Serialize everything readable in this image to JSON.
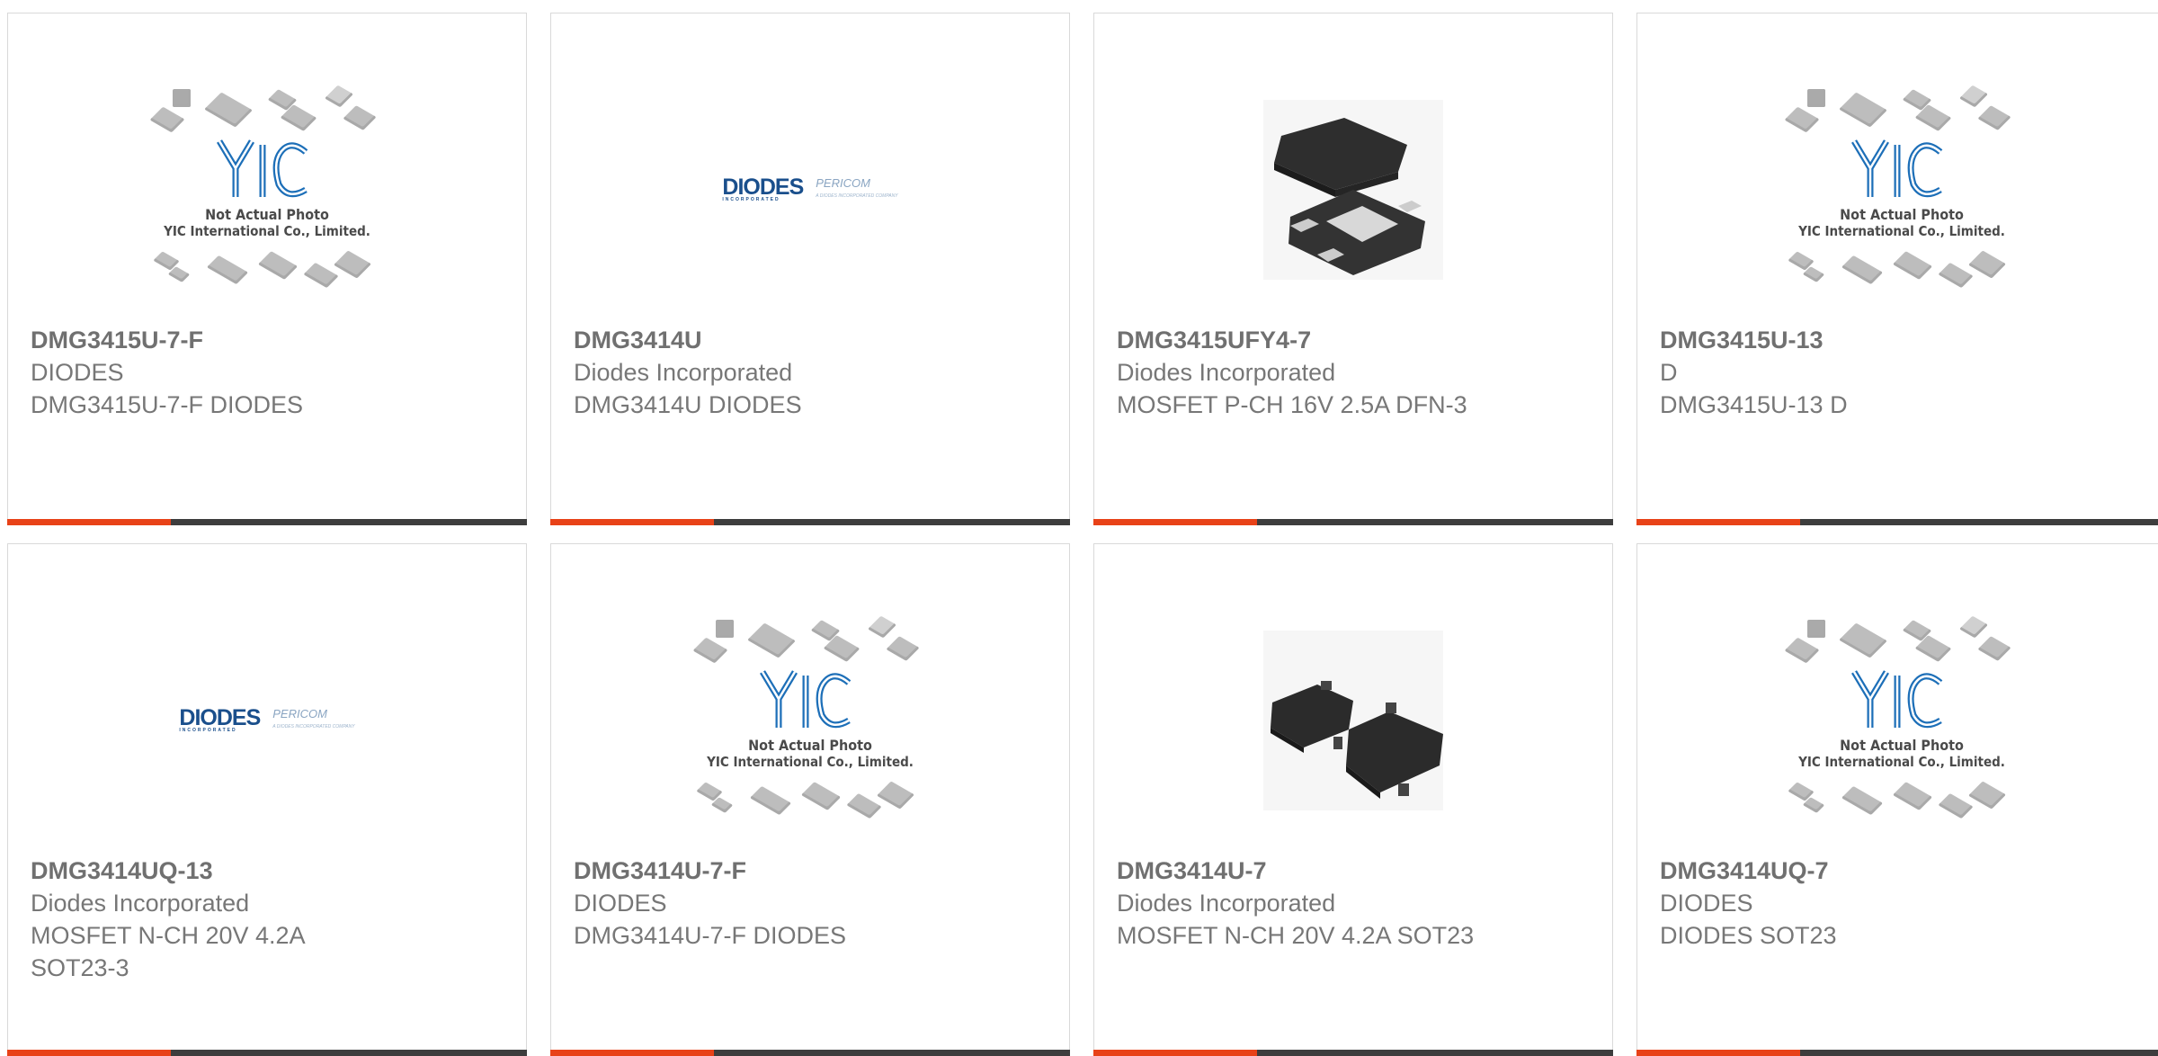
{
  "products": [
    {
      "part": "DMG3415U-7-F",
      "maker": "DIODES",
      "desc": "DMG3415U-7-F DIODES",
      "image": "yic-placeholder",
      "placeholder_text": [
        "Not Actual Photo",
        "YIC International Co., Limited."
      ]
    },
    {
      "part": "DMG3414U",
      "maker": "Diodes Incorporated",
      "desc": "DMG3414U DIODES",
      "image": "diodes-logo",
      "logo_text": [
        "DIODES",
        "PERICOM"
      ]
    },
    {
      "part": "DMG3415UFY4-7",
      "maker": "Diodes Incorporated",
      "desc": "MOSFET P-CH 16V 2.5A DFN-3",
      "image": "dfn-package-photo"
    },
    {
      "part": "DMG3415U-13",
      "maker": "D",
      "desc": "DMG3415U-13 D",
      "image": "yic-placeholder",
      "placeholder_text": [
        "Not Actual Photo",
        "YIC International Co., Limited."
      ]
    },
    {
      "part": "DMG3414UQ-13",
      "maker": "Diodes Incorporated",
      "desc": "MOSFET N-CH 20V 4.2A SOT23-3",
      "image": "diodes-logo",
      "logo_text": [
        "DIODES",
        "PERICOM"
      ]
    },
    {
      "part": "DMG3414U-7-F",
      "maker": "DIODES",
      "desc": "DMG3414U-7-F DIODES",
      "image": "yic-placeholder",
      "placeholder_text": [
        "Not Actual Photo",
        "YIC International Co., Limited."
      ]
    },
    {
      "part": "DMG3414U-7",
      "maker": "Diodes Incorporated",
      "desc": "MOSFET N-CH 20V 4.2A SOT23",
      "image": "sot23-package-photo"
    },
    {
      "part": "DMG3414UQ-7",
      "maker": "DIODES",
      "desc": "DIODES SOT23",
      "image": "yic-placeholder",
      "placeholder_text": [
        "Not Actual Photo",
        "YIC International Co., Limited."
      ]
    }
  ],
  "colors": {
    "accent": "#e84218",
    "bar": "#3d3d3d",
    "text": "#6a6a6a",
    "diodes_blue": "#1a4f8c"
  }
}
